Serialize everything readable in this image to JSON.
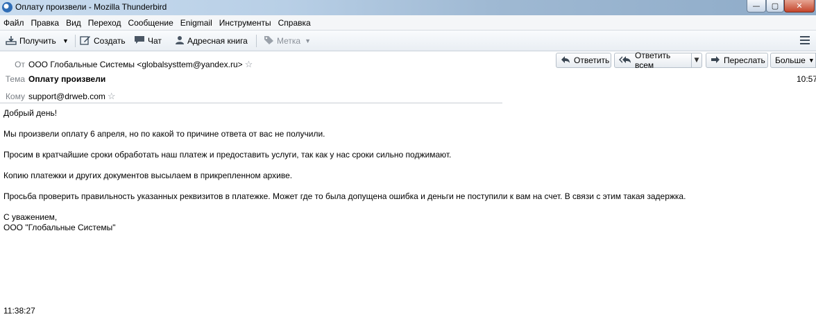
{
  "window": {
    "title": "Оплату произвели - Mozilla Thunderbird",
    "minimize_glyph": "—",
    "maximize_glyph": "▢",
    "close_glyph": "✕"
  },
  "menu": [
    "Файл",
    "Правка",
    "Вид",
    "Переход",
    "Сообщение",
    "Enigmail",
    "Инструменты",
    "Справка"
  ],
  "toolbar": {
    "get_label": "Получить",
    "compose_label": "Создать",
    "chat_label": "Чат",
    "addressbook_label": "Адресная книга",
    "tag_label": "Метка"
  },
  "header": {
    "from_label": "От",
    "from_value": "ООО Глобальные Системы <globalsysttem@yandex.ru>",
    "subject_label": "Тема",
    "subject_value": "Оплату произвели",
    "to_label": "Кому",
    "to_value": "support@drweb.com",
    "time": "10:57"
  },
  "actions": {
    "reply_label": "Ответить",
    "reply_all_label": "Ответить всем",
    "forward_label": "Переслать",
    "more_label": "Больше"
  },
  "body": {
    "greeting": "Добрый день!",
    "p1": "Мы произвели оплату 6 апреля, но по какой то причине ответа от вас не получили.",
    "p2": "Просим в кратчайшие сроки обработать наш платеж и предоставить услуги, так как у нас сроки сильно поджимают.",
    "p3": "Копию платежки и других документов высылаем в прикрепленном архиве.",
    "p4": "Просьба проверить правильность указанных реквизитов в платежке. Может где то была допущена ошибка и деньги не поступили к вам на счет. В связи с этим такая задержка.",
    "sign1": "С уважением,",
    "sign2": "ООО \"Глобальные Системы\""
  },
  "footer_time": "11:38:27",
  "icons": {
    "app": "thunderbird-icon",
    "get": "download-icon",
    "compose": "pencil-icon",
    "chat": "speech-bubble-icon",
    "addressbook": "person-icon",
    "tag": "tag-icon",
    "reply": "reply-arrow-icon",
    "reply_all": "reply-all-arrow-icon",
    "forward": "forward-arrow-icon",
    "menu": "hamburger-icon",
    "star": "star-icon"
  }
}
